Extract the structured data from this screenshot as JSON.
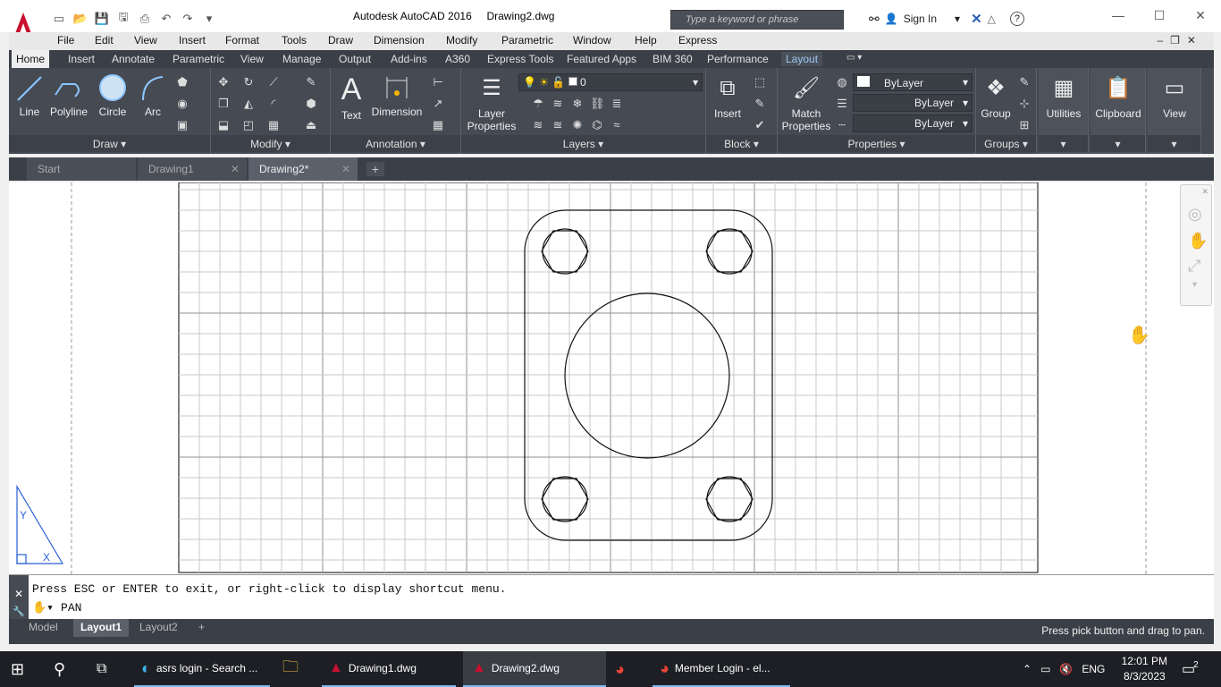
{
  "window": {
    "app_title": "Autodesk AutoCAD 2016",
    "file_title": "Drawing2.dwg",
    "search_placeholder": "Type a keyword or phrase",
    "sign_in": "Sign In"
  },
  "menu": [
    "File",
    "Edit",
    "View",
    "Insert",
    "Format",
    "Tools",
    "Draw",
    "Dimension",
    "Modify",
    "Parametric",
    "Window",
    "Help",
    "Express"
  ],
  "ribbon_tabs": [
    "Home",
    "Insert",
    "Annotate",
    "Parametric",
    "View",
    "Manage",
    "Output",
    "Add-ins",
    "A360",
    "Express Tools",
    "Featured Apps",
    "BIM 360",
    "Performance",
    "Layout"
  ],
  "ribbon": {
    "draw": {
      "title": "Draw",
      "line": "Line",
      "polyline": "Polyline",
      "circle": "Circle",
      "arc": "Arc"
    },
    "modify": {
      "title": "Modify"
    },
    "annotation": {
      "title": "Annotation",
      "text": "Text",
      "dimension": "Dimension"
    },
    "layers": {
      "title": "Layers",
      "layer_properties": "Layer Properties",
      "current_layer": "0"
    },
    "block": {
      "title": "Block",
      "insert": "Insert"
    },
    "properties": {
      "title": "Properties",
      "match": "Match Properties",
      "color": "ByLayer",
      "linetype": "ByLayer",
      "lineweight": "ByLayer"
    },
    "groups": {
      "title": "Groups",
      "group": "Group"
    },
    "utilities": {
      "label": "Utilities"
    },
    "clipboard": {
      "label": "Clipboard"
    },
    "view": {
      "label": "View"
    }
  },
  "doc_tabs": {
    "start": "Start",
    "drawing1": "Drawing1",
    "drawing2": "Drawing2*"
  },
  "command": {
    "message": "Press ESC or ENTER to exit, or right-click to display shortcut menu.",
    "current": "PAN"
  },
  "layout_tabs": {
    "model": "Model",
    "layout1": "Layout1",
    "layout2": "Layout2"
  },
  "status": {
    "message": "Press pick button and drag to pan."
  },
  "taskbar": {
    "search_edge": "asrs login - Search ...",
    "drawing1": "Drawing1.dwg",
    "drawing2": "Drawing2.dwg",
    "member": "Member Login - el...",
    "lang": "ENG",
    "time": "12:01 PM",
    "date": "8/3/2023",
    "notif_count": "2"
  },
  "ucs": {
    "x": "X",
    "y": "Y"
  },
  "colors": {
    "ribbon_bg": "#454a53",
    "tab_bg": "#3b4048",
    "accent": "#c8102e"
  }
}
